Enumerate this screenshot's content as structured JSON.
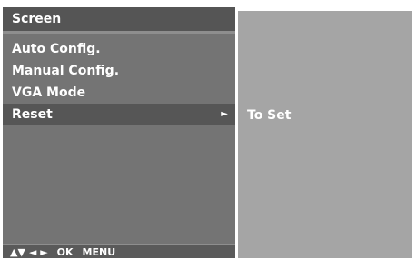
{
  "menu": {
    "title": "Screen",
    "items": [
      {
        "label": "Auto Config."
      },
      {
        "label": "Manual Config."
      },
      {
        "label": "VGA Mode"
      },
      {
        "label": "Reset",
        "arrow": "►"
      }
    ],
    "selected_label": "Reset"
  },
  "footer": {
    "up_down": "▲▼",
    "left_right": "◄ ►",
    "ok": "OK",
    "menu": "MENU"
  },
  "submenu": {
    "label": "To Set"
  },
  "colors": {
    "panel": "#747474",
    "header": "#555555",
    "selected_row": "#565656",
    "submenu_panel": "#a5a5a5",
    "text": "#ffffff"
  }
}
